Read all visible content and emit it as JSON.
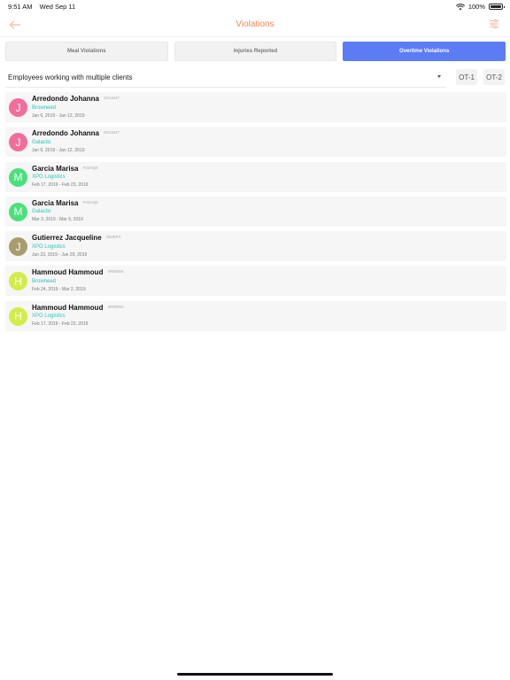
{
  "status_bar": {
    "time": "9:51 AM",
    "date": "Wed Sep 11",
    "battery": "100%"
  },
  "nav": {
    "title": "Violations",
    "back_icon": "arrow-left-icon",
    "filter_icon": "sliders-icon",
    "title_color": "#f08a5d"
  },
  "tabs": [
    {
      "label": "Meal Violations",
      "active": false
    },
    {
      "label": "Injuries Reported",
      "active": false
    },
    {
      "label": "Overtime Violations",
      "active": true
    }
  ],
  "filter": {
    "selected": "Employees working with multiple clients",
    "ot_buttons": [
      "OT-1",
      "OT-2"
    ]
  },
  "employees": [
    {
      "initial": "J",
      "name": "Arredondo Johanna",
      "id": "SOLW47",
      "client": "Browneed",
      "dates": "Jan 6, 2019 - Jan 12, 2019",
      "color": "#f06e9a"
    },
    {
      "initial": "J",
      "name": "Arredondo Johanna",
      "id": "SOLW47",
      "client": "Galactic",
      "dates": "Jan 6, 2019 - Jan 12, 2019",
      "color": "#f06e9a"
    },
    {
      "initial": "M",
      "name": "Garcia Marisa",
      "id": "F31HQ9",
      "client": "XPO Logistics",
      "dates": "Feb 17, 2019 - Feb 23, 2019",
      "color": "#4be07c"
    },
    {
      "initial": "M",
      "name": "Garcia Marisa",
      "id": "F31HQ9",
      "client": "Galactic",
      "dates": "Mar 3, 2019 - Mar 9, 2019",
      "color": "#4be07c"
    },
    {
      "initial": "J",
      "name": "Gutierrez Jacqueline",
      "id": "1E6EP4",
      "client": "XPO Logistics",
      "dates": "Jun 23, 2019 - Jun 29, 2019",
      "color": "#a89c6e"
    },
    {
      "initial": "H",
      "name": "Hammoud Hammoud",
      "id": "4RM0NA",
      "client": "Browneed",
      "dates": "Feb 24, 2019 - Mar 2, 2019",
      "color": "#d4ec4a"
    },
    {
      "initial": "H",
      "name": "Hammoud Hammoud",
      "id": "4RM0NA",
      "client": "XPO Logistics",
      "dates": "Feb 17, 2019 - Feb 23, 2019",
      "color": "#d4ec4a"
    }
  ]
}
